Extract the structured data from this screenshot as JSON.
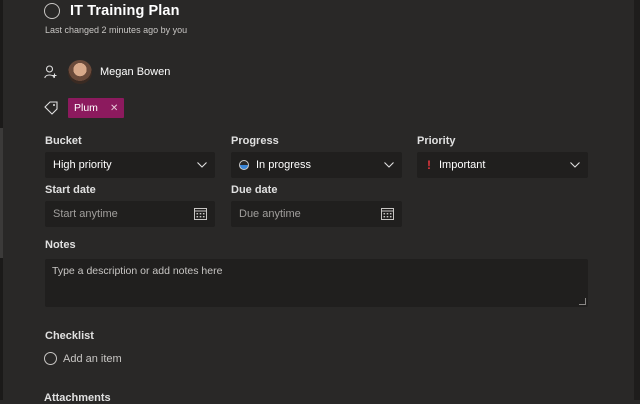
{
  "task": {
    "title": "IT Training Plan",
    "last_changed": "Last changed 2 minutes ago by you"
  },
  "assignment": {
    "assignee_name": "Megan Bowen"
  },
  "labels": [
    {
      "name": "Plum",
      "color": "#8c1a5e"
    }
  ],
  "fields": {
    "bucket": {
      "label": "Bucket",
      "value": "High priority"
    },
    "progress": {
      "label": "Progress",
      "value": "In progress"
    },
    "priority": {
      "label": "Priority",
      "value": "Important",
      "icon": "!"
    },
    "start_date": {
      "label": "Start date",
      "placeholder": "Start anytime"
    },
    "due_date": {
      "label": "Due date",
      "placeholder": "Due anytime"
    }
  },
  "notes": {
    "label": "Notes",
    "placeholder": "Type a description or add notes here"
  },
  "checklist": {
    "label": "Checklist",
    "add_item": "Add an item"
  },
  "attachments": {
    "label": "Attachments"
  },
  "icons": {
    "complete": "circle-icon",
    "assign": "person-add-icon",
    "label": "tag-icon",
    "chip_close": "close-icon",
    "dropdown": "chevron-down-icon",
    "calendar": "calendar-icon",
    "progress": "half-circle-icon",
    "priority": "exclamation-icon"
  }
}
